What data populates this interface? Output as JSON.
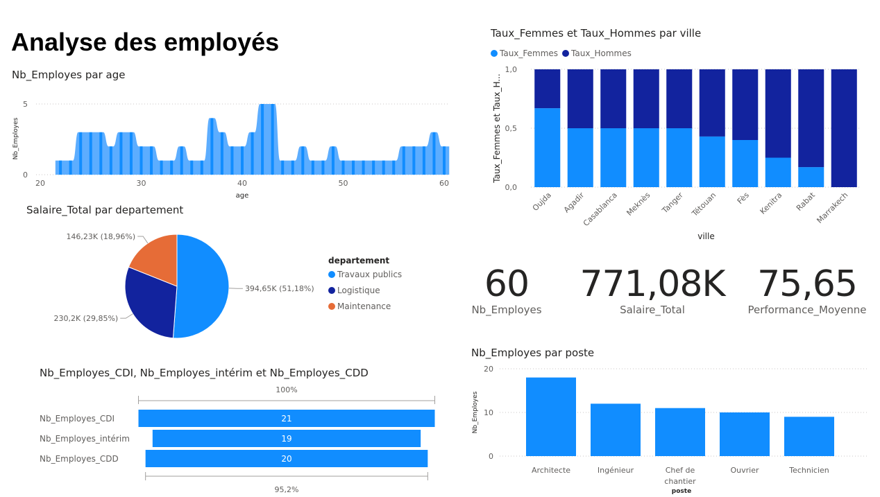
{
  "page": {
    "title": "Analyse des employés"
  },
  "colors": {
    "primary": "#118DFF",
    "secondary": "#12239E",
    "tertiary": "#E66C37",
    "light": "#5CADFF"
  },
  "cards": [
    {
      "value": "60",
      "label": "Nb_Employes"
    },
    {
      "value": "771,08K",
      "label": "Salaire_Total"
    },
    {
      "value": "75,65",
      "label": "Performance_Moyenne"
    }
  ],
  "chart_data": [
    {
      "id": "age",
      "type": "area",
      "title": "Nb_Employes par age",
      "xlabel": "age",
      "ylabel": "Nb_Employes",
      "xlim": [
        20,
        60
      ],
      "ylim": [
        0,
        5
      ],
      "x_ticks": [
        "20",
        "30",
        "40",
        "50",
        "60"
      ],
      "y_ticks": [
        "0",
        "5"
      ],
      "x": [
        22,
        23,
        24,
        25,
        26,
        27,
        28,
        29,
        30,
        31,
        32,
        33,
        34,
        35,
        36,
        37,
        38,
        39,
        40,
        41,
        42,
        43,
        44,
        45,
        46,
        47,
        48,
        49,
        50,
        51,
        52,
        53,
        54,
        55,
        56,
        57,
        58,
        59,
        60
      ],
      "values": [
        1,
        1,
        3,
        3,
        3,
        2,
        3,
        3,
        2,
        2,
        1,
        1,
        2,
        1,
        1,
        4,
        3,
        2,
        2,
        3,
        5,
        5,
        1,
        1,
        2,
        1,
        1,
        2,
        1,
        1,
        1,
        1,
        1,
        1,
        2,
        2,
        2,
        3,
        2
      ]
    },
    {
      "id": "ville",
      "type": "bar",
      "stacked": "100%",
      "title": "Taux_Femmes et Taux_Hommes par ville",
      "xlabel": "ville",
      "ylabel": "Taux_Femmes et Taux_H...",
      "ylim": [
        0,
        1
      ],
      "y_ticks": [
        "0,0",
        "0,5",
        "1,0"
      ],
      "legend": "top-left",
      "categories": [
        "Oujda",
        "Agadir",
        "Casablanca",
        "Meknès",
        "Tanger",
        "Tétouan",
        "Fès",
        "Kenitra",
        "Rabat",
        "Marrakech"
      ],
      "series": [
        {
          "name": "Taux_Femmes",
          "values": [
            0.67,
            0.5,
            0.5,
            0.5,
            0.5,
            0.43,
            0.4,
            0.25,
            0.17,
            0.0
          ]
        },
        {
          "name": "Taux_Hommes",
          "values": [
            0.33,
            0.5,
            0.5,
            0.5,
            0.5,
            0.57,
            0.6,
            0.75,
            0.83,
            1.0
          ]
        }
      ]
    },
    {
      "id": "pie",
      "type": "pie",
      "title": "Salaire_Total par departement",
      "legend_title": "departement",
      "legend": "right",
      "categories": [
        "Travaux publics",
        "Logistique",
        "Maintenance"
      ],
      "values": [
        394.65,
        230.2,
        146.23
      ],
      "labels": [
        "394,65K (51,18%)",
        "230,2K (29,85%)",
        "146,23K (18,96%)"
      ]
    },
    {
      "id": "funnel",
      "type": "bar",
      "orientation": "horizontal-funnel",
      "title": "Nb_Employes_CDI, Nb_Employes_intérim et Nb_Employes_CDD",
      "categories": [
        "Nb_Employes_CDI",
        "Nb_Employes_intérim",
        "Nb_Employes_CDD"
      ],
      "values": [
        21,
        19,
        20
      ],
      "top_label": "100%",
      "bottom_label": "95,2%"
    },
    {
      "id": "poste",
      "type": "bar",
      "title": "Nb_Employes par poste",
      "xlabel": "poste",
      "ylabel": "Nb_Employes",
      "ylim": [
        0,
        20
      ],
      "y_ticks": [
        "0",
        "10",
        "20"
      ],
      "categories": [
        "Architecte",
        "Ingénieur",
        "Chef de chantier",
        "Ouvrier",
        "Technicien"
      ],
      "values": [
        18,
        12,
        11,
        10,
        9
      ]
    }
  ]
}
